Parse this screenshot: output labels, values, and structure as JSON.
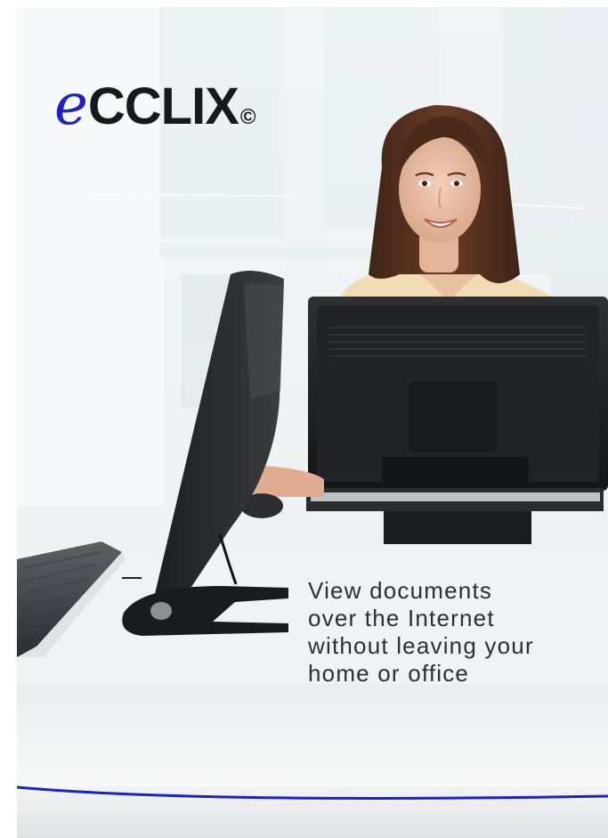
{
  "logo": {
    "letter_e": "e",
    "word": "CCLIX",
    "copyright": "©"
  },
  "tagline": {
    "lines": [
      "View documents",
      "over the Internet",
      "without leaving your",
      "home or office"
    ]
  },
  "colors": {
    "brand_blue": "#1a22c8",
    "wordmark": "#18191d",
    "tagline": "#2b2e33",
    "accent_line": "#1a22c8"
  },
  "icons": [
    "copyright-symbol"
  ]
}
